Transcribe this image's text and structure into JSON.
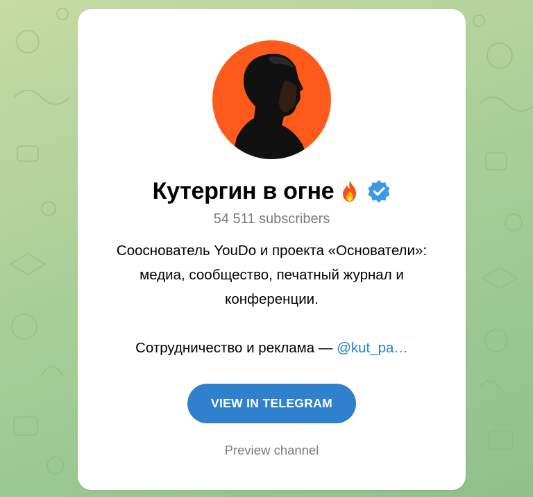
{
  "channel": {
    "title": "Кутергин в огне",
    "title_emoji_icon": "fire-icon",
    "verified_icon": "verified-check-icon",
    "subscribers": "54 511 subscribers",
    "description_lines": [
      "Сооснователь YouDo и проекта «Основатели»:",
      "медиа, сообщество, печатный журнал и",
      "конференции."
    ],
    "contact_prefix": "Сотрудничество и реклама — ",
    "contact_link": "@kut_pa…"
  },
  "actions": {
    "view_button": "VIEW IN TELEGRAM",
    "preview_link": "Preview channel"
  },
  "colors": {
    "accent": "#2f80cd",
    "link": "#2481cc",
    "avatar_bg": "#fd5a1c",
    "muted_text": "#7b7b7b",
    "background": "#a9cf98"
  }
}
